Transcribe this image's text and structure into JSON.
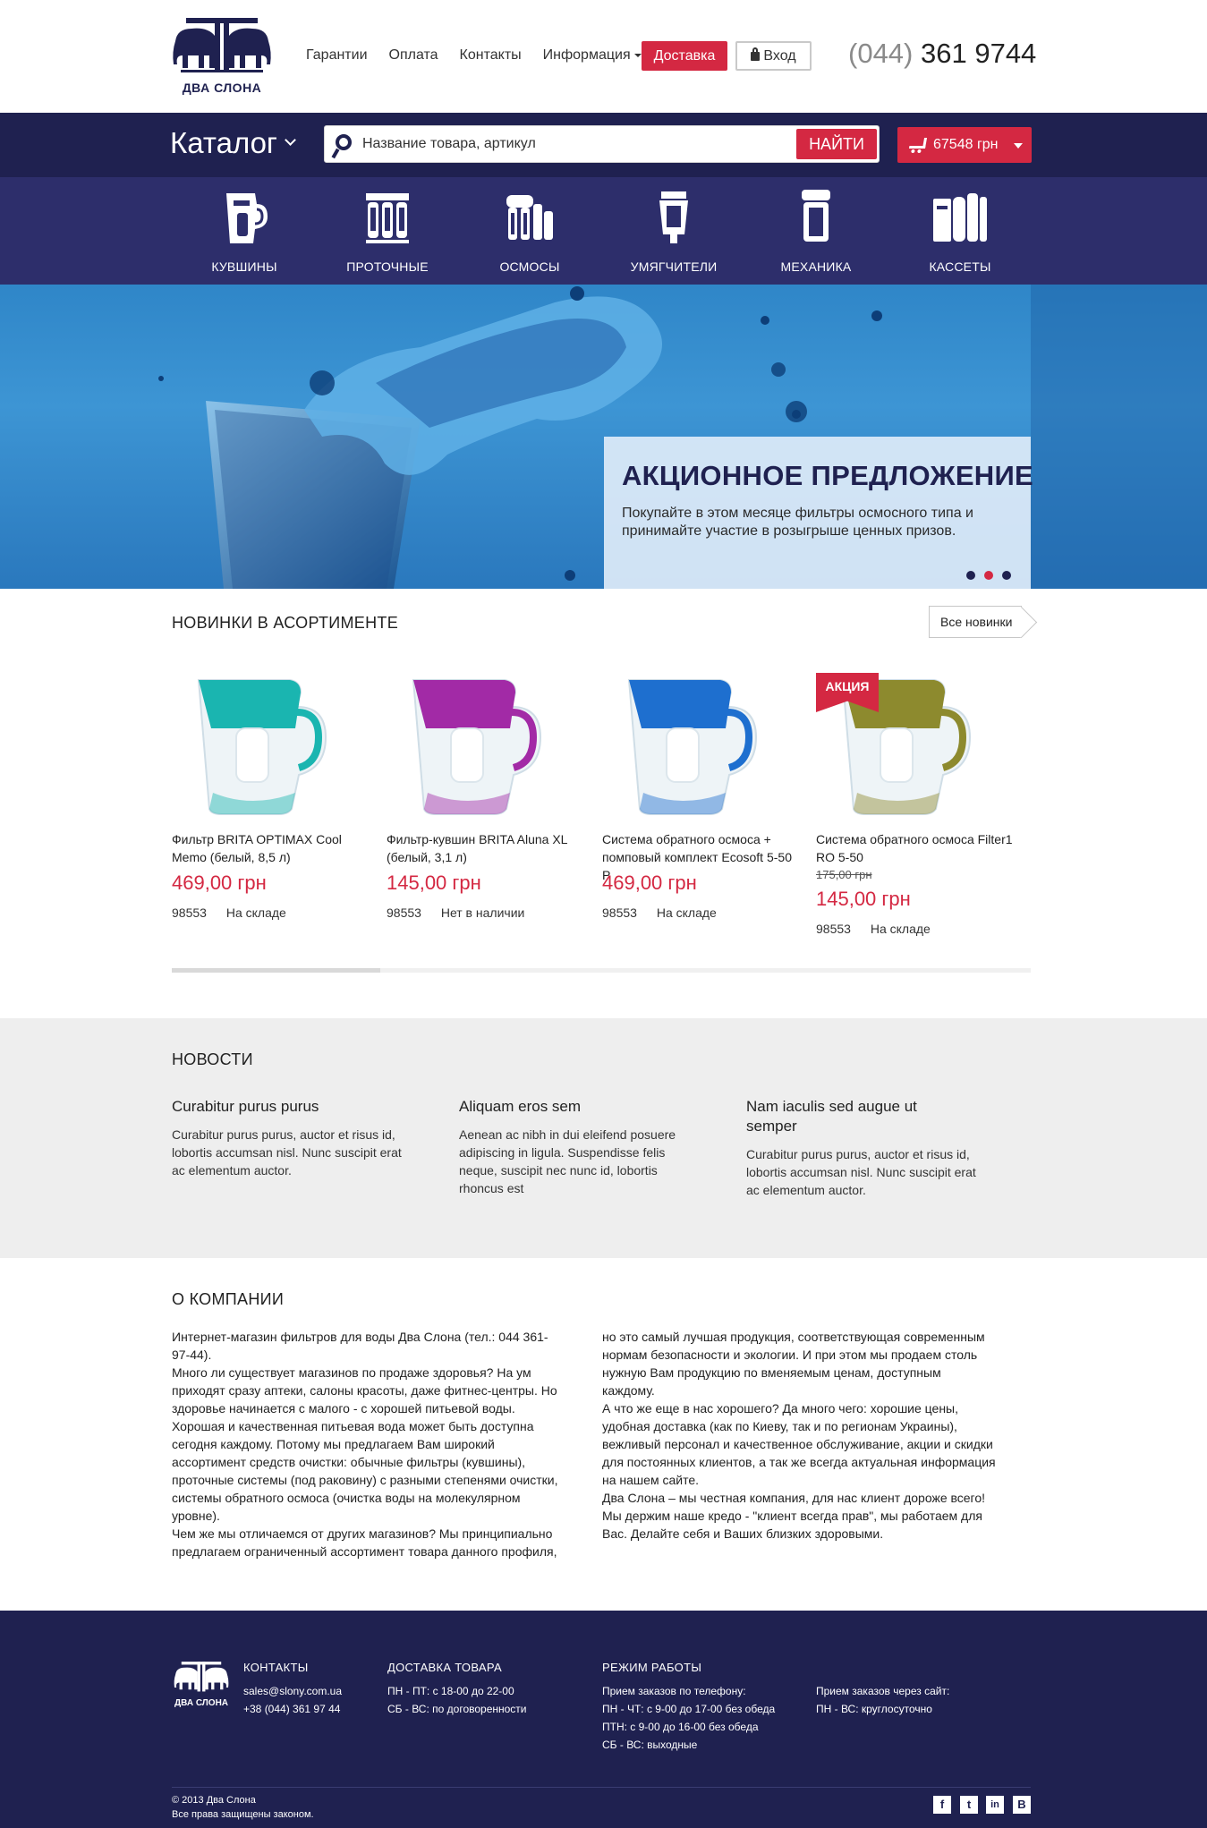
{
  "brand": {
    "logo_text": "ДВА СЛОНА"
  },
  "header": {
    "nav": [
      "Гарантии",
      "Оплата",
      "Контакты",
      "Информация"
    ],
    "delivery_button": "Доставка",
    "login_button": "Вход",
    "phone_code": "(044)",
    "phone_number": "361 9744"
  },
  "catalog_bar": {
    "title": "Каталог",
    "search_placeholder": "Название товара, артикул",
    "search_button": "НАЙТИ",
    "cart_total": "67548 грн"
  },
  "categories": [
    "КУВШИНЫ",
    "ПРОТОЧНЫЕ",
    "ОСМОСЫ",
    "УМЯГЧИТЕЛИ",
    "МЕХАНИКА",
    "КАССЕТЫ"
  ],
  "hero": {
    "title": "АКЦИОННОЕ ПРЕДЛОЖЕНИЕ",
    "text": "Покупайте в этом месяце фильтры осмосного типа и принимайте участие в розыгрыше ценных призов.",
    "active_slide": 2,
    "slides": 3
  },
  "new_products": {
    "heading": "НОВИНКИ В АСОРТИМЕНТЕ",
    "all_button": "Все новинки",
    "scroll_position": 0.24,
    "items": [
      {
        "name": "Фильтр BRITA OPTIMAX Cool Memo (белый, 8,5 л)",
        "price": "469,00 грн",
        "old_price": "",
        "sku": "98553",
        "stock": "На складе",
        "color": "#1ab5b0"
      },
      {
        "name": "Фильтр-кувшин BRITA Aluna XL (белый, 3,1 л)",
        "price": "145,00 грн",
        "old_price": "",
        "sku": "98553",
        "stock": "Нет в наличии",
        "color": "#a22aa6"
      },
      {
        "name": "Система обратного осмоса + помповый комплект Ecosoft 5-50 P",
        "price": "469,00 грн",
        "old_price": "",
        "sku": "98553",
        "stock": "На складе",
        "color": "#1e6fcf"
      },
      {
        "name": "Система обратного осмоса Filter1 RO 5-50",
        "price": "145,00 грн",
        "old_price": "175,00 грн",
        "sku": "98553",
        "stock": "На складе",
        "color": "#8d8a2e",
        "badge": "АКЦИЯ"
      }
    ]
  },
  "news": {
    "heading": "НОВОСТИ",
    "items": [
      {
        "title": "Curabitur purus purus",
        "text": "Curabitur purus purus, auctor et risus id, lobortis accumsan nisl. Nunc suscipit erat ac elementum auctor."
      },
      {
        "title": "Aliquam eros sem",
        "text": "Aenean ac nibh in dui eleifend posuere adipiscing in ligula. Suspendisse felis neque, suscipit nec nunc id, lobortis rhoncus est"
      },
      {
        "title": "Nam iaculis sed augue ut semper",
        "text": "Curabitur purus purus, auctor et risus id, lobortis accumsan nisl. Nunc suscipit erat ac elementum auctor."
      }
    ]
  },
  "about": {
    "heading": "О КОМПАНИИ",
    "col1": [
      "Интернет-магазин фильтров для воды Два Слона (тел.: 044 361-97-44).",
      "Много ли существует магазинов по продаже здоровья? На ум приходят сразу аптеки, салоны красоты, даже фитнес-центры. Но здоровье начинается с малого - с хорошей питьевой воды. Хорошая и качественная питьевая вода может быть доступна сегодня каждому. Потому мы предлагаем Вам широкий ассортимент средств очистки: обычные фильтры (кувшины), проточные системы (под раковину) с разными степенями очистки, системы обратного осмоса (очистка воды на молекулярном уровне).",
      "Чем же мы отличаемся от других магазинов? Мы принципиально предлагаем ограниченный ассортимент товара данного профиля,"
    ],
    "col2": [
      "но это самый лучшая продукция, соответствующая современным нормам безопасности и экологии. И при этом мы продаем столь нужную Вам продукцию по вменяемым ценам, доступным каждому.",
      "А что же еще в нас хорошего? Да много чего: хорошие цены, удобная доставка (как по Киеву, так и по регионам Украины), вежливый персонал и качественное обслуживание, акции и скидки для постоянных клиентов, а так же всегда актуальная информация на нашем сайте.",
      "Два Слона – мы честная компания, для нас клиент дороже всего! Мы держим наше кредо - \"клиент всегда прав\", мы работаем для Вас. Делайте себя и Ваших близких здоровыми."
    ]
  },
  "footer": {
    "logo_text": "ДВА СЛОНА",
    "contacts": {
      "heading": "КОНТАКТЫ",
      "email": "sales@slony.com.ua",
      "phone": "+38 (044) 361 97 44"
    },
    "delivery": {
      "heading": "ДОСТАВКА ТОВАРА",
      "lines": [
        "ПН - ПТ: с 18-00 до 22-00",
        "СБ - ВС: по договоренности"
      ]
    },
    "hours": {
      "heading": "РЕЖИМ РАБОТЫ",
      "phone_title": "Прием заказов по телефону:",
      "phone_lines": [
        "ПН - ЧТ: с 9-00 до 17-00 без обеда",
        "ПТН: с 9-00 до 16-00 без обеда",
        "СБ - ВС: выходные"
      ],
      "site_title": "Прием заказов через сайт:",
      "site_line": "ПН - ВС: круглосуточно"
    },
    "copyright": "© 2013 Два Слона",
    "rights": "Все права защищены законом.",
    "social": [
      "f",
      "t",
      "in",
      "В"
    ]
  }
}
